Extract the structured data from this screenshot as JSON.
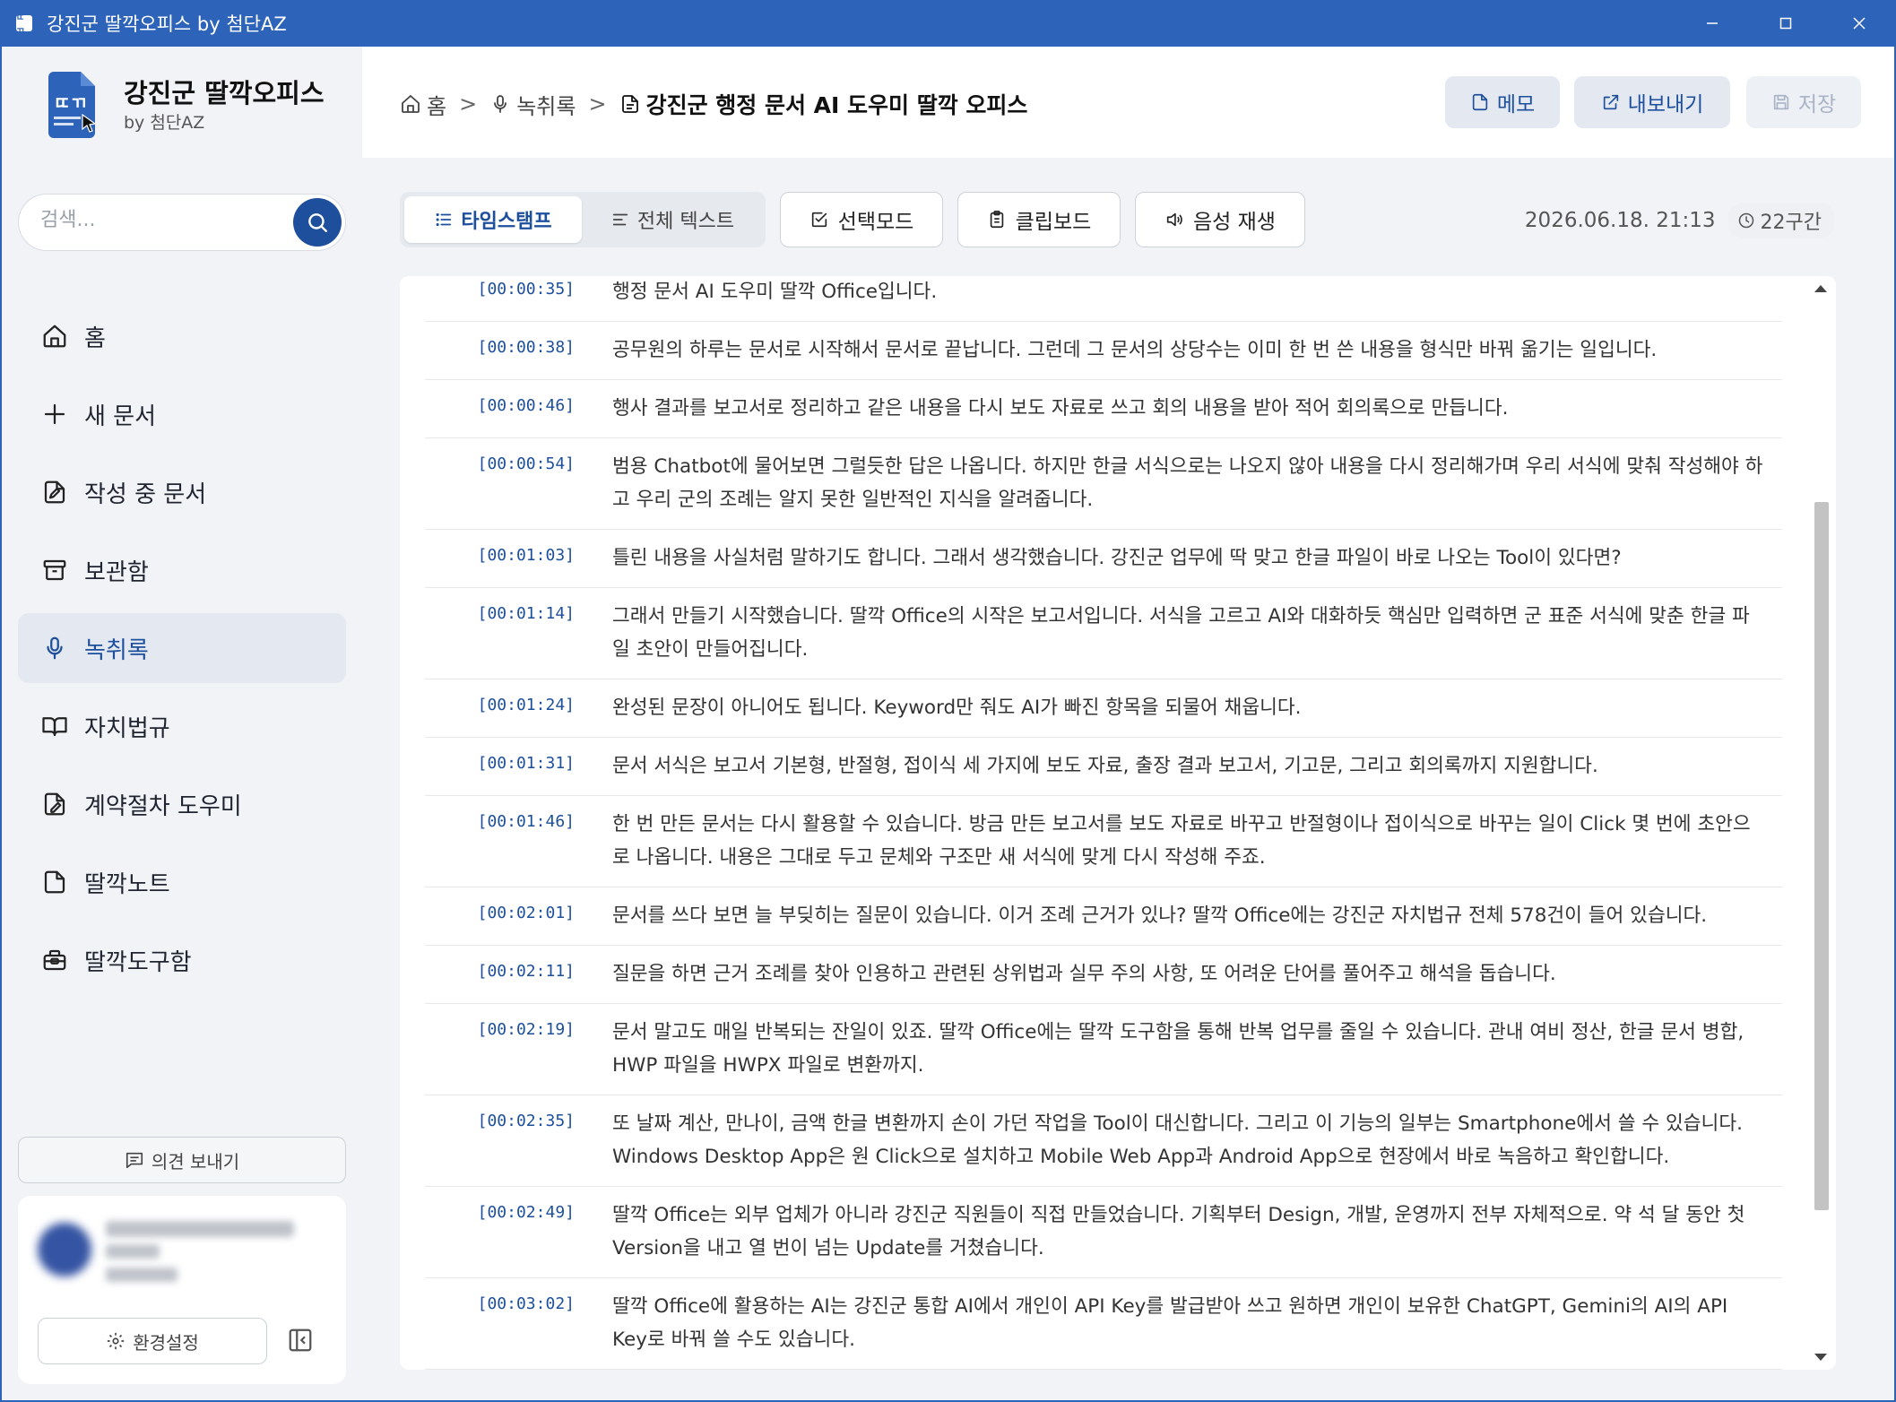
{
  "window": {
    "title": "강진군 딸깍오피스 by 첨단AZ",
    "app_icon_text": "ㄸㄲ"
  },
  "brand": {
    "logo_text": "ㄸㄲ",
    "name": "강진군 딸깍오피스",
    "sub": "by 첨단AZ"
  },
  "search": {
    "placeholder": "검색..."
  },
  "nav": [
    {
      "label": "홈",
      "icon": "home-icon"
    },
    {
      "label": "새 문서",
      "icon": "plus-icon"
    },
    {
      "label": "작성 중 문서",
      "icon": "file-edit-icon"
    },
    {
      "label": "보관함",
      "icon": "archive-icon"
    },
    {
      "label": "녹취록",
      "icon": "microphone-icon",
      "active": true
    },
    {
      "label": "자치법규",
      "icon": "book-icon"
    },
    {
      "label": "계약절차 도우미",
      "icon": "contract-icon"
    },
    {
      "label": "딸깍노트",
      "icon": "note-icon"
    },
    {
      "label": "딸깍도구함",
      "icon": "toolbox-icon"
    }
  ],
  "feedback": {
    "label": "의견 보내기"
  },
  "settings": {
    "label": "환경설정"
  },
  "breadcrumb": {
    "home": "홈",
    "section": "녹취록",
    "current": "강진군 행정 문서 AI 도우미 딸깍 오피스"
  },
  "header_buttons": {
    "memo": "메모",
    "export": "내보내기",
    "save": "저장"
  },
  "toolbar": {
    "view_timestamp": "타임스탬프",
    "view_fulltext": "전체 텍스트",
    "select_mode": "선택모드",
    "clipboard": "클립보드",
    "play_audio": "음성 재생",
    "datetime": "2026.06.18. 21:13",
    "segments": "22구간"
  },
  "accent_color": "#1d4f9c",
  "titlebar_color": "#2d63b8",
  "scroll_position": 0.35,
  "transcript": [
    {
      "time": "[00:00:35]",
      "text": "행정 문서 AI 도우미 딸깍 Office입니다."
    },
    {
      "time": "[00:00:38]",
      "text": "공무원의 하루는 문서로 시작해서 문서로 끝납니다. 그런데 그 문서의 상당수는 이미 한 번 쓴 내용을 형식만 바꿔 옮기는 일입니다."
    },
    {
      "time": "[00:00:46]",
      "text": "행사 결과를 보고서로 정리하고 같은 내용을 다시 보도 자료로 쓰고 회의 내용을 받아 적어 회의록으로 만듭니다."
    },
    {
      "time": "[00:00:54]",
      "text": "범용 Chatbot에 물어보면 그럴듯한 답은 나옵니다. 하지만 한글 서식으로는 나오지 않아 내용을 다시 정리해가며 우리 서식에 맞춰 작성해야 하고 우리 군의 조례는 알지 못한 일반적인 지식을 알려줍니다."
    },
    {
      "time": "[00:01:03]",
      "text": "틀린 내용을 사실처럼 말하기도 합니다. 그래서 생각했습니다. 강진군 업무에 딱 맞고 한글 파일이 바로 나오는 Tool이 있다면?"
    },
    {
      "time": "[00:01:14]",
      "text": "그래서 만들기 시작했습니다. 딸깍 Office의 시작은 보고서입니다. 서식을 고르고 AI와 대화하듯 핵심만 입력하면 군 표준 서식에 맞춘 한글 파일 초안이 만들어집니다."
    },
    {
      "time": "[00:01:24]",
      "text": "완성된 문장이 아니어도 됩니다. Keyword만 줘도 AI가 빠진 항목을 되물어 채웁니다."
    },
    {
      "time": "[00:01:31]",
      "text": "문서 서식은 보고서 기본형, 반절형, 접이식 세 가지에 보도 자료, 출장 결과 보고서, 기고문, 그리고 회의록까지 지원합니다."
    },
    {
      "time": "[00:01:46]",
      "text": "한 번 만든 문서는 다시 활용할 수 있습니다. 방금 만든 보고서를 보도 자료로 바꾸고 반절형이나 접이식으로 바꾸는 일이 Click 몇 번에 초안으로 나옵니다. 내용은 그대로 두고 문체와 구조만 새 서식에 맞게 다시 작성해 주죠."
    },
    {
      "time": "[00:02:01]",
      "text": "문서를 쓰다 보면 늘 부딪히는 질문이 있습니다. 이거 조례 근거가 있나? 딸깍 Office에는 강진군 자치법규 전체 578건이 들어 있습니다."
    },
    {
      "time": "[00:02:11]",
      "text": "질문을 하면 근거 조례를 찾아 인용하고 관련된 상위법과 실무 주의 사항, 또 어려운 단어를 풀어주고 해석을 돕습니다."
    },
    {
      "time": "[00:02:19]",
      "text": "문서 말고도 매일 반복되는 잔일이 있죠. 딸깍 Office에는 딸깍 도구함을 통해 반복 업무를 줄일 수 있습니다. 관내 여비 정산, 한글 문서 병합, HWP 파일을 HWPX 파일로 변환까지."
    },
    {
      "time": "[00:02:35]",
      "text": "또 날짜 계산, 만나이, 금액 한글 변환까지 손이 가던 작업을 Tool이 대신합니다. 그리고 이 기능의 일부는 Smartphone에서 쓸 수 있습니다. Windows Desktop App은 원 Click으로 설치하고 Mobile Web App과 Android App으로 현장에서 바로 녹음하고 확인합니다."
    },
    {
      "time": "[00:02:49]",
      "text": "딸깍 Office는 외부 업체가 아니라 강진군 직원들이 직접 만들었습니다. 기획부터 Design, 개발, 운영까지 전부 자체적으로. 약 석 달 동안 첫 Version을 내고 열 번이 넘는 Update를 거쳤습니다."
    },
    {
      "time": "[00:03:02]",
      "text": "딸깍 Office에 활용하는 AI는 강진군 통합 AI에서 개인이 API Key를 발급받아 쓰고 원하면 개인이 보유한 ChatGPT, Gemini의 AI의 API Key로 바꿔 쓸 수도 있습니다."
    }
  ]
}
